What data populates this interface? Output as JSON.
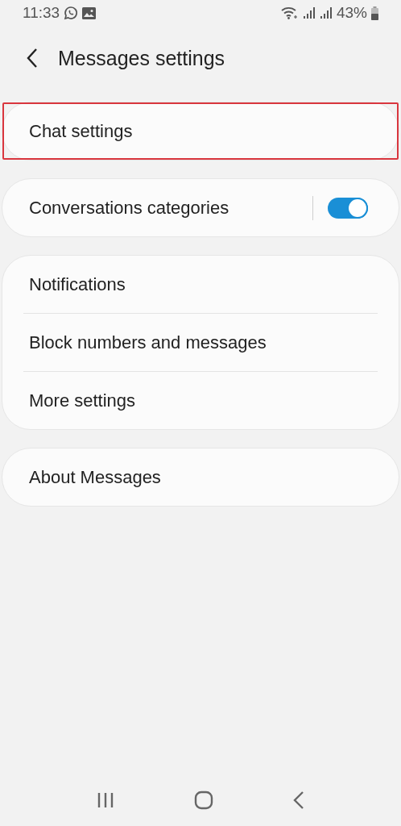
{
  "status_bar": {
    "time": "11:33",
    "battery": "43%"
  },
  "header": {
    "title": "Messages settings"
  },
  "groups": [
    {
      "items": [
        {
          "kind": "link",
          "label": "Chat settings",
          "highlighted": true
        }
      ]
    },
    {
      "items": [
        {
          "kind": "switch",
          "label": "Conversations categories",
          "on": true,
          "highlighted": false
        }
      ]
    },
    {
      "items": [
        {
          "kind": "link",
          "label": "Notifications",
          "highlighted": false
        },
        {
          "kind": "link",
          "label": "Block numbers and messages",
          "highlighted": false
        },
        {
          "kind": "link",
          "label": "More settings",
          "highlighted": false
        }
      ]
    },
    {
      "items": [
        {
          "kind": "link",
          "label": "About Messages",
          "highlighted": false
        }
      ]
    }
  ]
}
